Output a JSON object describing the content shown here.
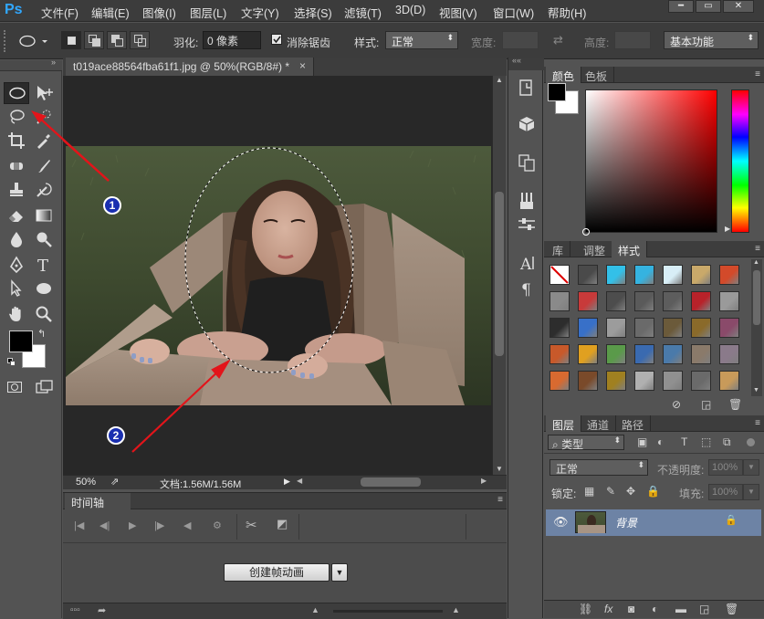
{
  "app": {
    "logo": "Ps"
  },
  "menubar": {
    "items": [
      "文件(F)",
      "编辑(E)",
      "图像(I)",
      "图层(L)",
      "文字(Y)",
      "选择(S)",
      "滤镜(T)",
      "3D(D)",
      "视图(V)",
      "窗口(W)",
      "帮助(H)"
    ],
    "minimize": "━",
    "restore": "▭",
    "close": "✕"
  },
  "options": {
    "feather_label": "羽化:",
    "feather_value": "0 像素",
    "antialias_label": "消除锯齿",
    "style_label": "样式:",
    "style_value": "正常",
    "width_label": "宽度:",
    "height_label": "高度:",
    "workspace": "基本功能"
  },
  "document": {
    "tab_title": "t019ace88564fba61f1.jpg @ 50%(RGB/8#) *",
    "close": "×",
    "zoom": "50%",
    "doc_info": "文档:1.56M/1.56M",
    "annotation_1": "1",
    "annotation_2": "2"
  },
  "timeline": {
    "tab": "时间轴",
    "create_button": "创建帧动画",
    "dropdown": "▼"
  },
  "color_panel": {
    "tabs": [
      "颜色",
      "色板"
    ],
    "colors": {
      "foreground": "#000000",
      "background": "#ffffff",
      "accent": "#31a8ff"
    }
  },
  "swatches_panel": {
    "tabs": [
      "库",
      "调整",
      "样式"
    ],
    "styles": [
      "#ffffff",
      "#4a4a4a",
      "#33c0e8",
      "#35b3e0",
      "#d8eef7",
      "#c9a96a",
      "#d34a2a",
      "#8a8a8a",
      "#c83a3a",
      "#4d4d4d",
      "#5a5a5a",
      "#5d5d5d",
      "#b8222a",
      "#9a9a9a",
      "#2d2d2d",
      "#3870c8",
      "#9c9c9c",
      "#6a6a6a",
      "#6b5a3a",
      "#8a6a2a",
      "#8a4a6a",
      "#c8592a",
      "#e0a020",
      "#5a9a4a",
      "#3a6ab0",
      "#4a7aaa",
      "#8a7a6a",
      "#8a7a8a",
      "#d86a30",
      "#7a4a2a",
      "#a08020",
      "#b0b0b0",
      "#909090",
      "#6a6a6a",
      "#c89a5a"
    ]
  },
  "layers_panel": {
    "tabs": [
      "图层",
      "通道",
      "路径"
    ],
    "filter_kind": "类型",
    "blend_mode": "正常",
    "opacity_label": "不透明度:",
    "opacity_value": "100%",
    "lock_label": "锁定:",
    "fill_label": "填充:",
    "fill_value": "100%",
    "layer_name": "背景"
  }
}
